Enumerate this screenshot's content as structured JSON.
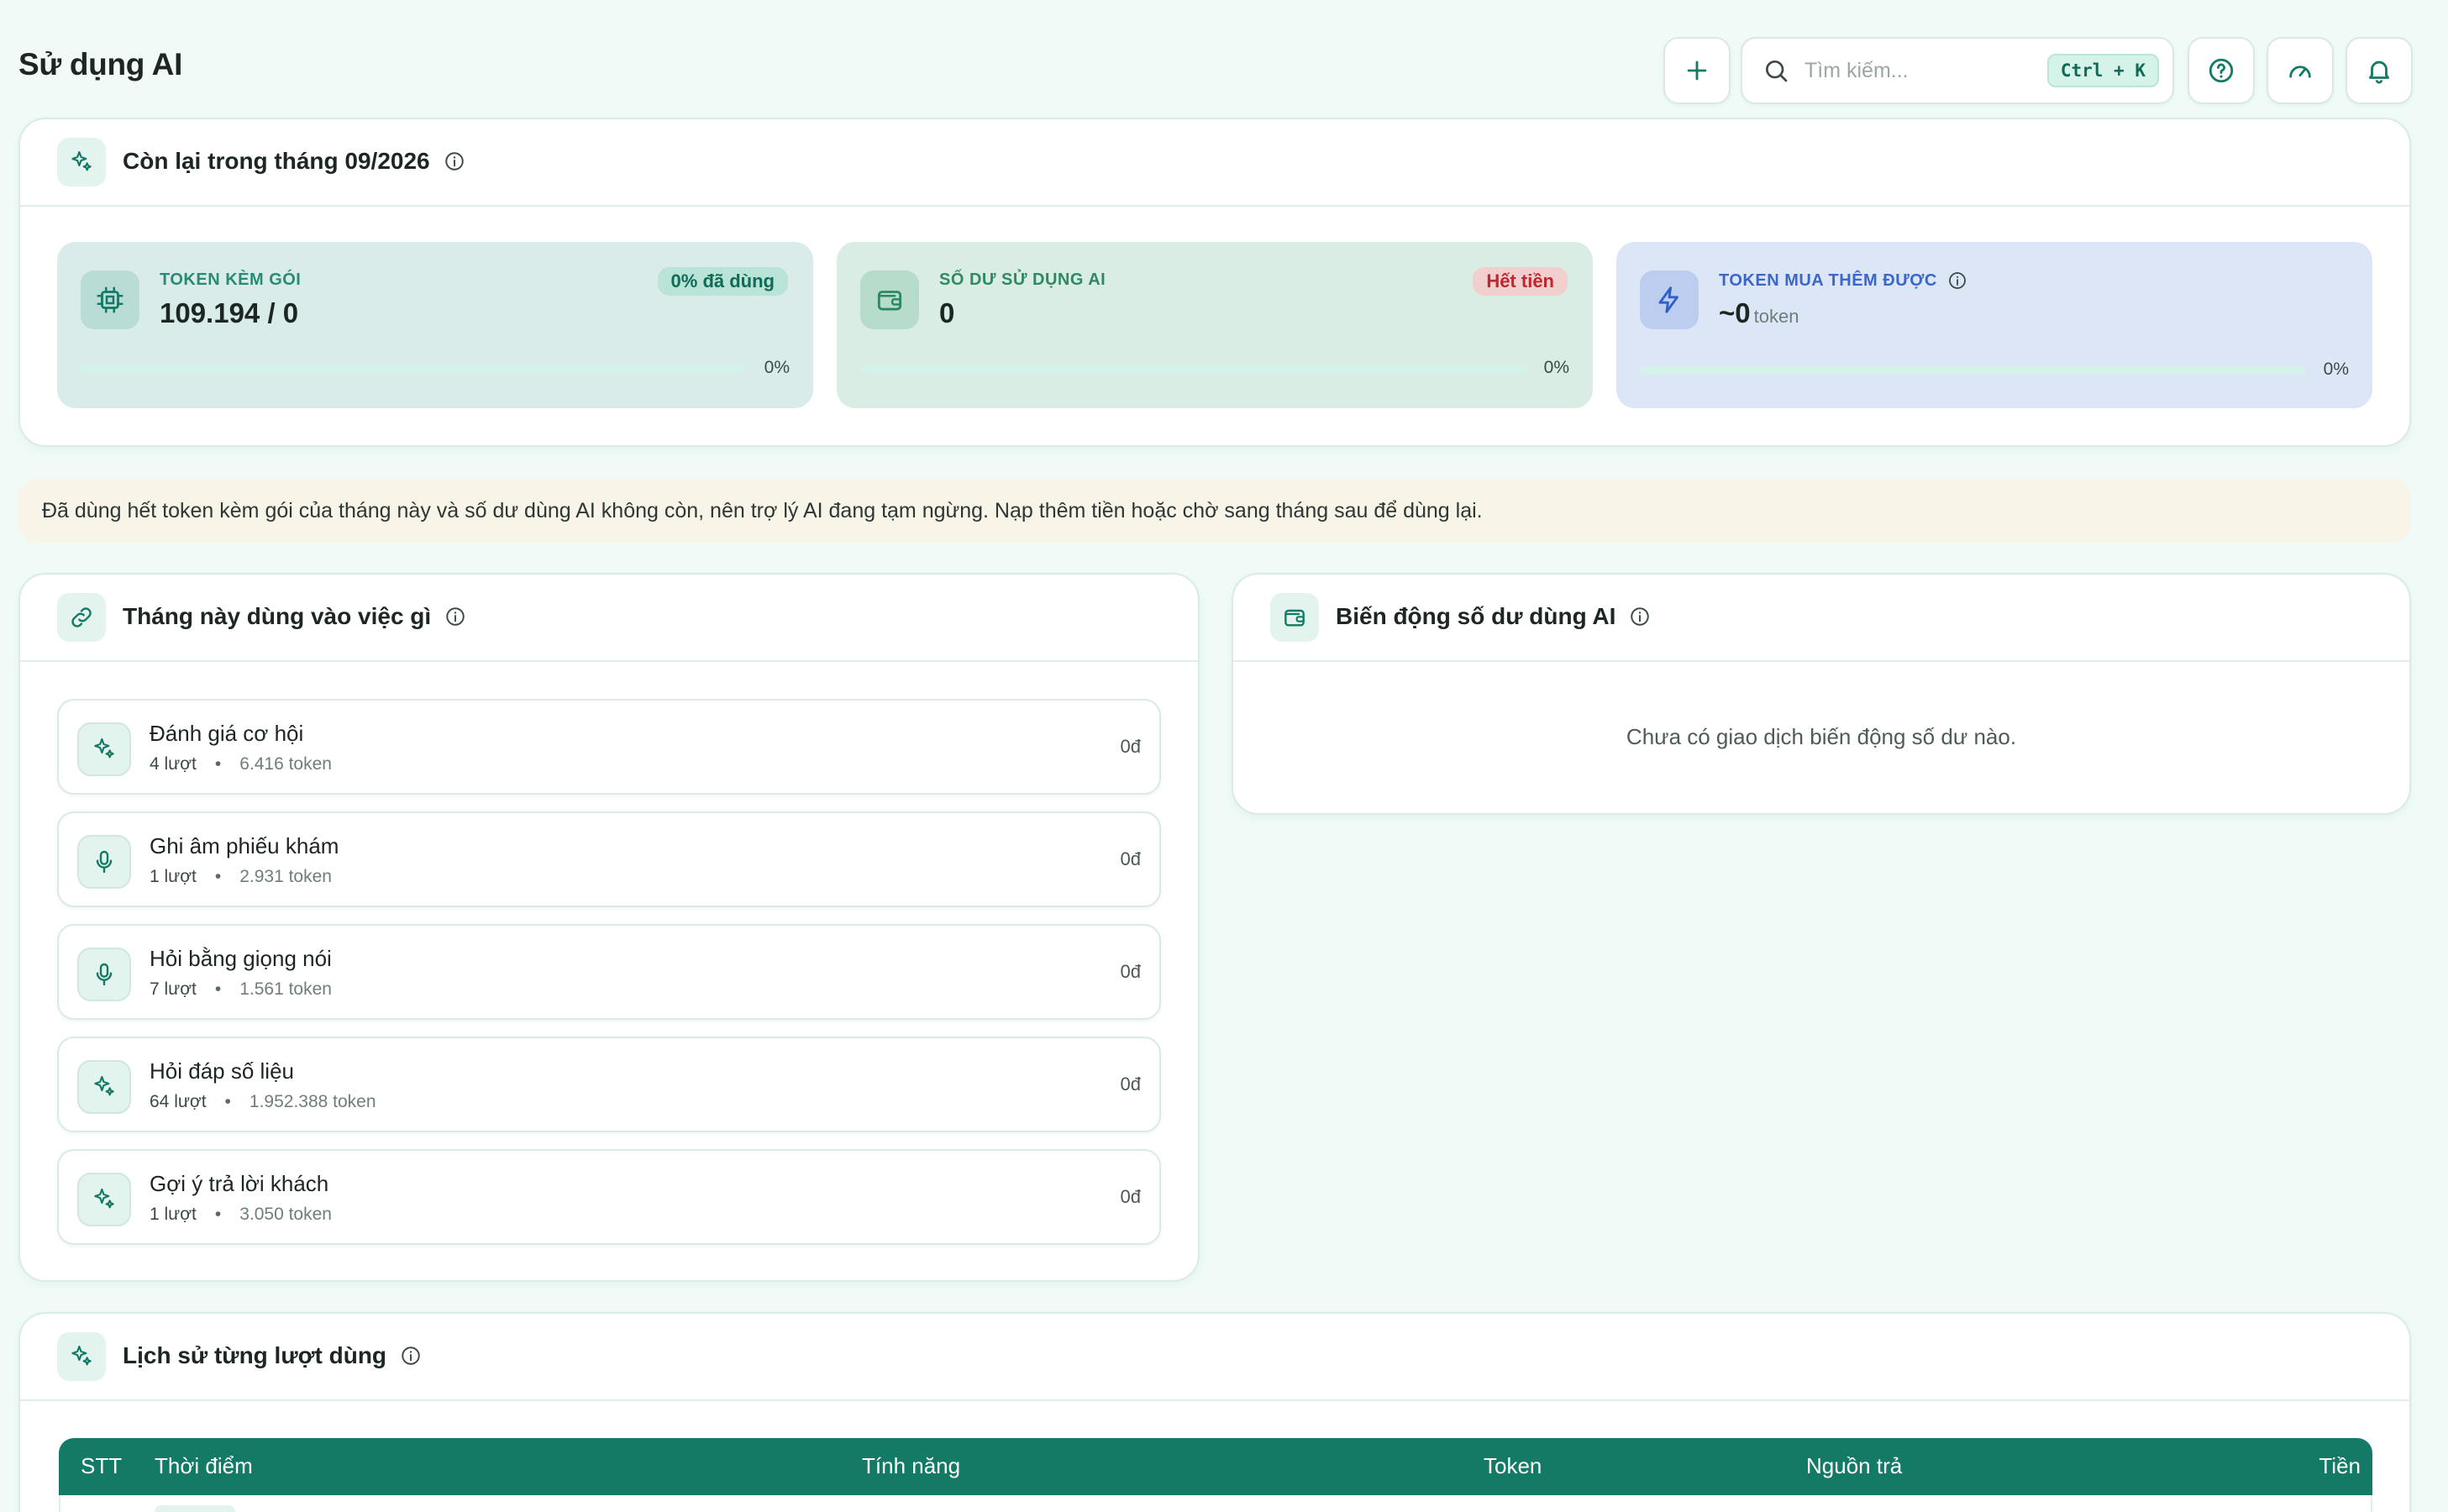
{
  "header": {
    "title": "Sử dụng AI",
    "search_placeholder": "Tìm kiếm...",
    "search_shortcut": "Ctrl + K",
    "icons": [
      "plus-icon",
      "search-icon",
      "help-icon",
      "gauge-icon",
      "bell-icon"
    ]
  },
  "remaining": {
    "title": "Còn lại trong tháng 09/2026",
    "tiles": [
      {
        "label": "TOKEN KÈM GÓI",
        "value": "109.194 / 0",
        "badge": "0% đã dùng",
        "percent": "0%",
        "progress": 0,
        "icon": "chip-icon"
      },
      {
        "label": "SỐ DƯ SỬ DỤNG AI",
        "value": "0",
        "badge": "Hết tiền",
        "percent": "0%",
        "progress": 0,
        "icon": "wallet-icon"
      },
      {
        "label": "TOKEN MUA THÊM ĐƯỢC",
        "value": "~0",
        "unit": "token",
        "percent": "0%",
        "progress": 0,
        "icon": "bolt-icon"
      }
    ]
  },
  "notice": "Đã dùng hết token kèm gói của tháng này và số dư dùng AI không còn, nên trợ lý AI đang tạm ngừng. Nạp thêm tiền hoặc chờ sang tháng sau để dùng lại.",
  "usage": {
    "title": "Tháng này dùng vào việc gì",
    "items": [
      {
        "name": "Đánh giá cơ hội",
        "count": "4 lượt",
        "tokens": "6.416 token",
        "cost": "0đ",
        "icon": "sparkle-icon"
      },
      {
        "name": "Ghi âm phiếu khám",
        "count": "1 lượt",
        "tokens": "2.931 token",
        "cost": "0đ",
        "icon": "microphone-icon"
      },
      {
        "name": "Hỏi bằng giọng nói",
        "count": "7 lượt",
        "tokens": "1.561 token",
        "cost": "0đ",
        "icon": "microphone-icon"
      },
      {
        "name": "Hỏi đáp số liệu",
        "count": "64 lượt",
        "tokens": "1.952.388 token",
        "cost": "0đ",
        "icon": "sparkle-icon"
      },
      {
        "name": "Gợi ý trả lời khách",
        "count": "1 lượt",
        "tokens": "3.050 token",
        "cost": "0đ",
        "icon": "sparkle-icon"
      }
    ]
  },
  "balance": {
    "title": "Biến động số dư dùng AI",
    "empty": "Chưa có giao dịch biến động số dư nào."
  },
  "history": {
    "title": "Lịch sử từng lượt dùng",
    "columns": [
      "STT",
      "Thời điểm",
      "Tính năng",
      "Token",
      "Nguồn trả",
      "Tiền"
    ]
  },
  "colors": {
    "accent": "#137a66",
    "page_bg": "#f0fbf8",
    "tile1_bg": "#d9ecea",
    "tile2_bg": "#d9ede4",
    "tile3_bg": "#dde6f7",
    "danger_badge": "#f2cfcf"
  }
}
